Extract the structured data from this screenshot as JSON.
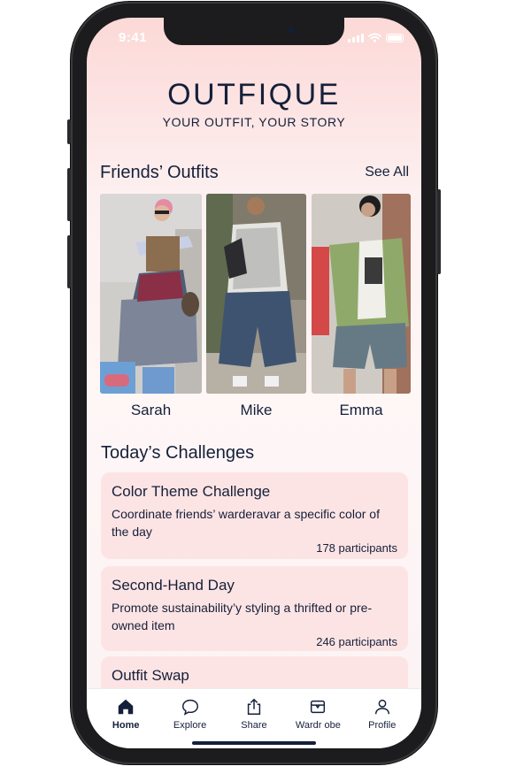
{
  "status_bar": {
    "time": "9:41"
  },
  "header": {
    "brand": "OUTFIQUE",
    "tagline": "YOUR OUTFIT, YOUR STORY"
  },
  "friends_section": {
    "title": "Friends’ Outfits",
    "see_all": "See All",
    "friends": [
      {
        "name": "Sarah"
      },
      {
        "name": "Mike"
      },
      {
        "name": "Emma"
      }
    ]
  },
  "challenges_section": {
    "title": "Today’s Challenges",
    "challenges": [
      {
        "title": "Color Theme Challenge",
        "description": "Coordinate friends’ warderavar a specific color of the day",
        "participants": "178 participants"
      },
      {
        "title": "Second-Hand Day",
        "description": "Promote sustainability’y styling a thrifted or pre-owned item",
        "participants": "246 participants"
      },
      {
        "title": "Outfit Swap",
        "description": "",
        "participants": ""
      }
    ]
  },
  "tab_bar": {
    "tabs": [
      {
        "label": "Home",
        "icon": "home-icon",
        "active": true
      },
      {
        "label": "Explore",
        "icon": "chat-bubble-icon",
        "active": false
      },
      {
        "label": "Share",
        "icon": "share-icon",
        "active": false
      },
      {
        "label": "Wardr obe",
        "icon": "wardrobe-icon",
        "active": false
      },
      {
        "label": "Profile",
        "icon": "person-icon",
        "active": false
      }
    ]
  },
  "colors": {
    "accent": "#15203a",
    "card_bg": "#fde4e4",
    "screen_top": "#fbd9d6"
  }
}
